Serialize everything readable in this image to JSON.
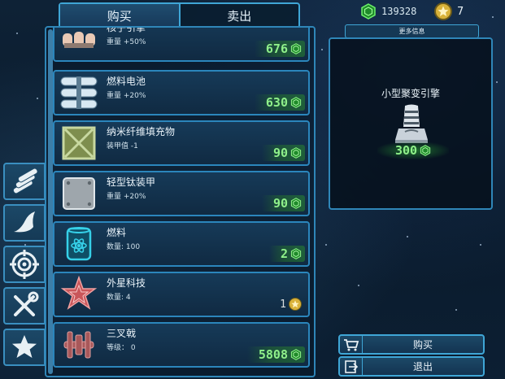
{
  "tabs": {
    "buy": "购买",
    "sell": "卖出"
  },
  "currency": {
    "credits": "139328",
    "stars": "7"
  },
  "categories": [
    {
      "icon": "cylinders-icon"
    },
    {
      "icon": "wing-icon"
    },
    {
      "icon": "crosshair-icon"
    },
    {
      "icon": "tools-icon"
    },
    {
      "icon": "star-icon"
    }
  ],
  "items": [
    {
      "name": "核子引擎",
      "stat": "重量 +50%",
      "price": "676",
      "icon": "engine-icon"
    },
    {
      "name": "燃料电池",
      "stat": "重量 +20%",
      "price": "630",
      "icon": "fuel-cells-icon"
    },
    {
      "name": "纳米纤维填充物",
      "stat": "装甲值 -1",
      "price": "90",
      "icon": "nanofiber-crate-icon"
    },
    {
      "name": "轻型钛装甲",
      "stat": "重量 +20%",
      "price": "90",
      "icon": "titanium-plate-icon"
    },
    {
      "name": "燃料",
      "stat": "数量: 100",
      "price": "2",
      "icon": "fuel-canister-icon"
    },
    {
      "name": "外星科技",
      "stat": "数量: 4",
      "price": "1",
      "icon": "alien-tech-icon",
      "currency": "star"
    },
    {
      "name": "三叉戟",
      "stat": "等级： 0",
      "price": "5808",
      "icon": "trident-ship-icon"
    }
  ],
  "info": {
    "tab_label": "更多信息",
    "item_name": "小型聚变引擎",
    "price": "300",
    "icon": "fusion-engine-icon"
  },
  "buttons": {
    "buy": "购买",
    "exit": "退出"
  },
  "colors": {
    "accent": "#3fa6d6",
    "price_green": "#8ff08a",
    "panel_bg": "#163a58"
  }
}
